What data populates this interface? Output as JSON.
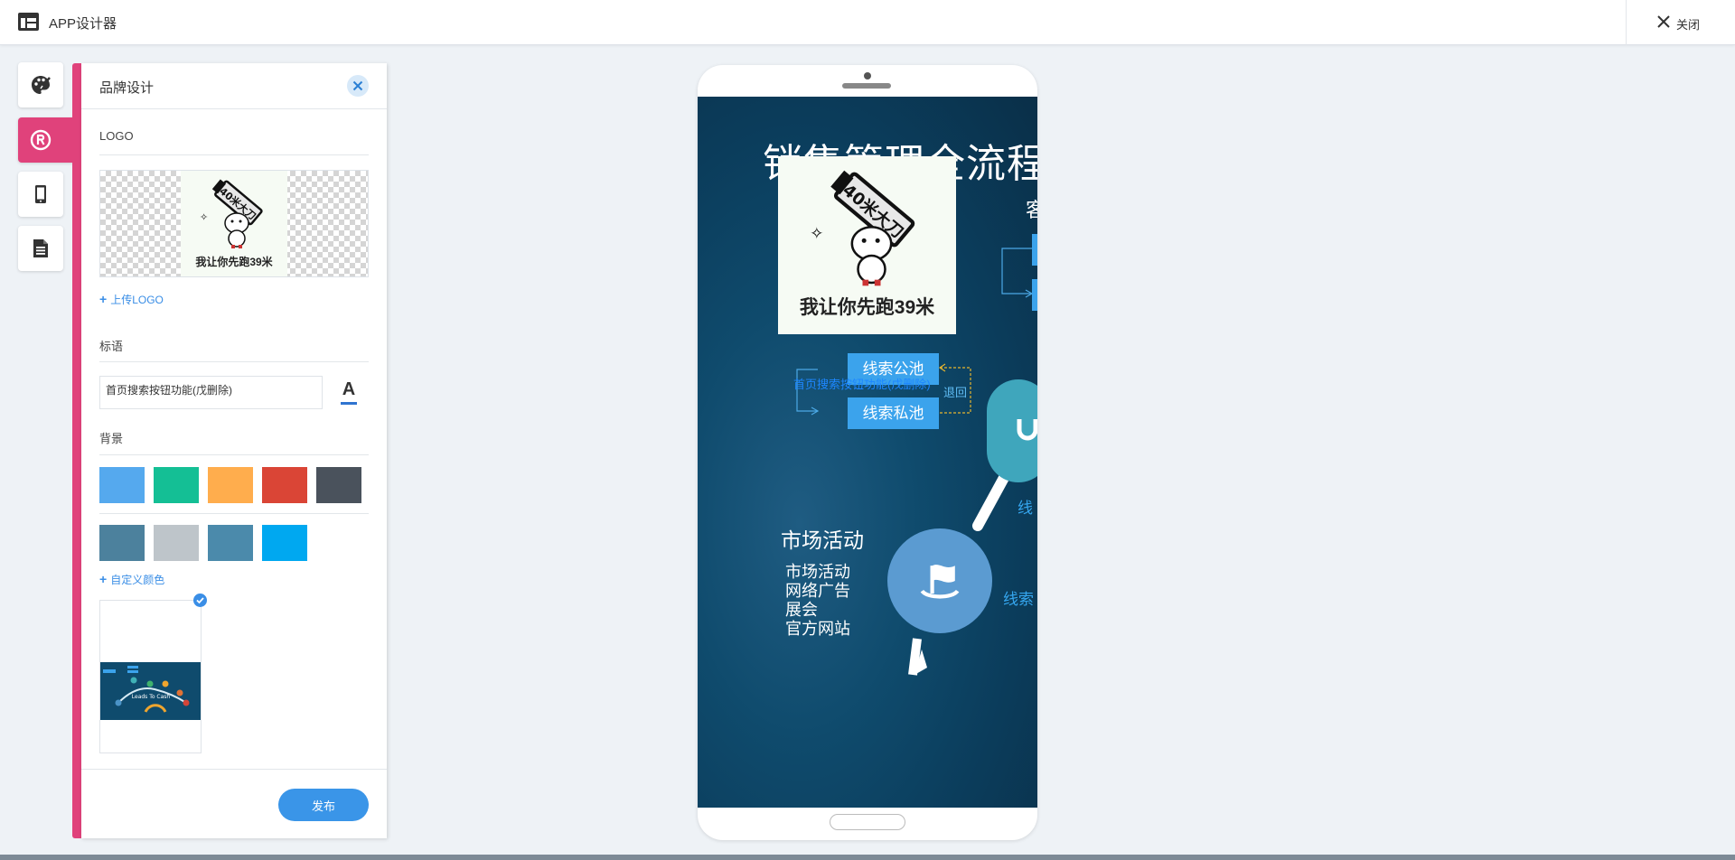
{
  "topbar": {
    "title": "APP设计器",
    "close_label": "关闭"
  },
  "rail": {
    "items": [
      "palette-icon",
      "registered-icon",
      "mobile-icon",
      "document-icon"
    ],
    "accent_color": "#e0427b"
  },
  "panel": {
    "title": "品牌设计",
    "logo": {
      "section_label": "LOGO",
      "image_caption": "我让你先跑39米",
      "sword_text": "40米大刀",
      "upload_label": "上传LOGO"
    },
    "slogan": {
      "section_label": "标语",
      "value": "首页搜索按钮功能(戊删除)",
      "font_button": "A"
    },
    "background": {
      "section_label": "背景",
      "swatches_row1": [
        "#55a9ee",
        "#14bf95",
        "#ffad4d",
        "#da4536",
        "#4a525c"
      ],
      "swatches_row2": [
        "#4c819d",
        "#bec5ca",
        "#4b8aab",
        "#00a8f0"
      ],
      "custom_color_label": "自定义颜色",
      "theme_thumbnail_text": "Leads To Cash"
    },
    "publish_label": "发布"
  },
  "preview": {
    "title": "销售管理全流程",
    "logo_caption": "我让你先跑39米",
    "sword_text": "40米大刀",
    "pool_public": "线索公池",
    "pool_private": "线索私池",
    "overlay_text": "首页搜索按钮功能(戊删除)",
    "return_label": "退回",
    "cut_char_top": "客",
    "cut_label_1": "线",
    "cut_label_2": "线索",
    "market": {
      "title": "市场活动",
      "items": [
        "市场活动",
        "网络广告",
        "展会",
        "官方网站"
      ]
    }
  }
}
